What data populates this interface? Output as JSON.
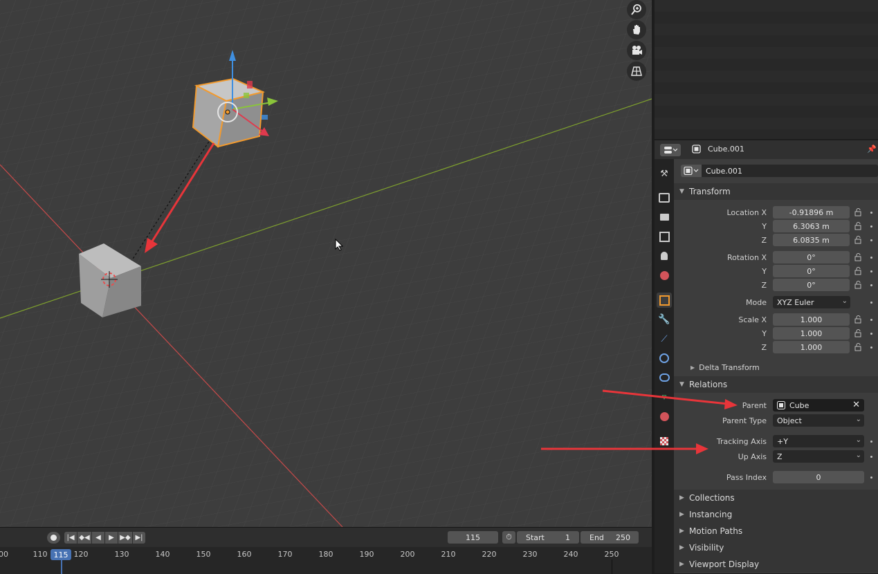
{
  "viewport": {
    "nav_icons": [
      "zoom-icon",
      "hand-pan-icon",
      "camera-icon",
      "perspective-grid-icon"
    ]
  },
  "timeline": {
    "current_frame": "115",
    "start_label": "Start",
    "start_value": "1",
    "end_label": "End",
    "end_value": "250",
    "ruler_labels": [
      "00",
      "110",
      "120",
      "130",
      "140",
      "150",
      "160",
      "170",
      "180",
      "190",
      "200",
      "210",
      "220",
      "230",
      "240",
      "250"
    ]
  },
  "properties": {
    "header_object": "Cube.001",
    "object_name": "Cube.001",
    "transform": {
      "title": "Transform",
      "location_label": "Location X",
      "location": [
        "-0.91896 m",
        "6.3063 m",
        "6.0835 m"
      ],
      "rotation_label": "Rotation X",
      "rotation": [
        "0°",
        "0°",
        "0°"
      ],
      "mode_label": "Mode",
      "mode_value": "XYZ Euler",
      "scale_label": "Scale X",
      "scale": [
        "1.000",
        "1.000",
        "1.000"
      ],
      "axis_y": "Y",
      "axis_z": "Z",
      "delta": "Delta Transform"
    },
    "relations": {
      "title": "Relations",
      "parent_label": "Parent",
      "parent_value": "Cube",
      "parent_type_label": "Parent Type",
      "parent_type_value": "Object",
      "tracking_label": "Tracking Axis",
      "tracking_value": "+Y",
      "up_label": "Up Axis",
      "up_value": "Z",
      "pass_label": "Pass Index",
      "pass_value": "0"
    },
    "collapsed_panels": [
      "Collections",
      "Instancing",
      "Motion Paths",
      "Visibility",
      "Viewport Display"
    ]
  },
  "colors": {
    "accent_blue": "#4772b3",
    "selection_orange": "#f29a2e",
    "annotation_red": "#e8353a",
    "x_axis": "#c94a4a",
    "y_axis": "#7fa12e"
  }
}
